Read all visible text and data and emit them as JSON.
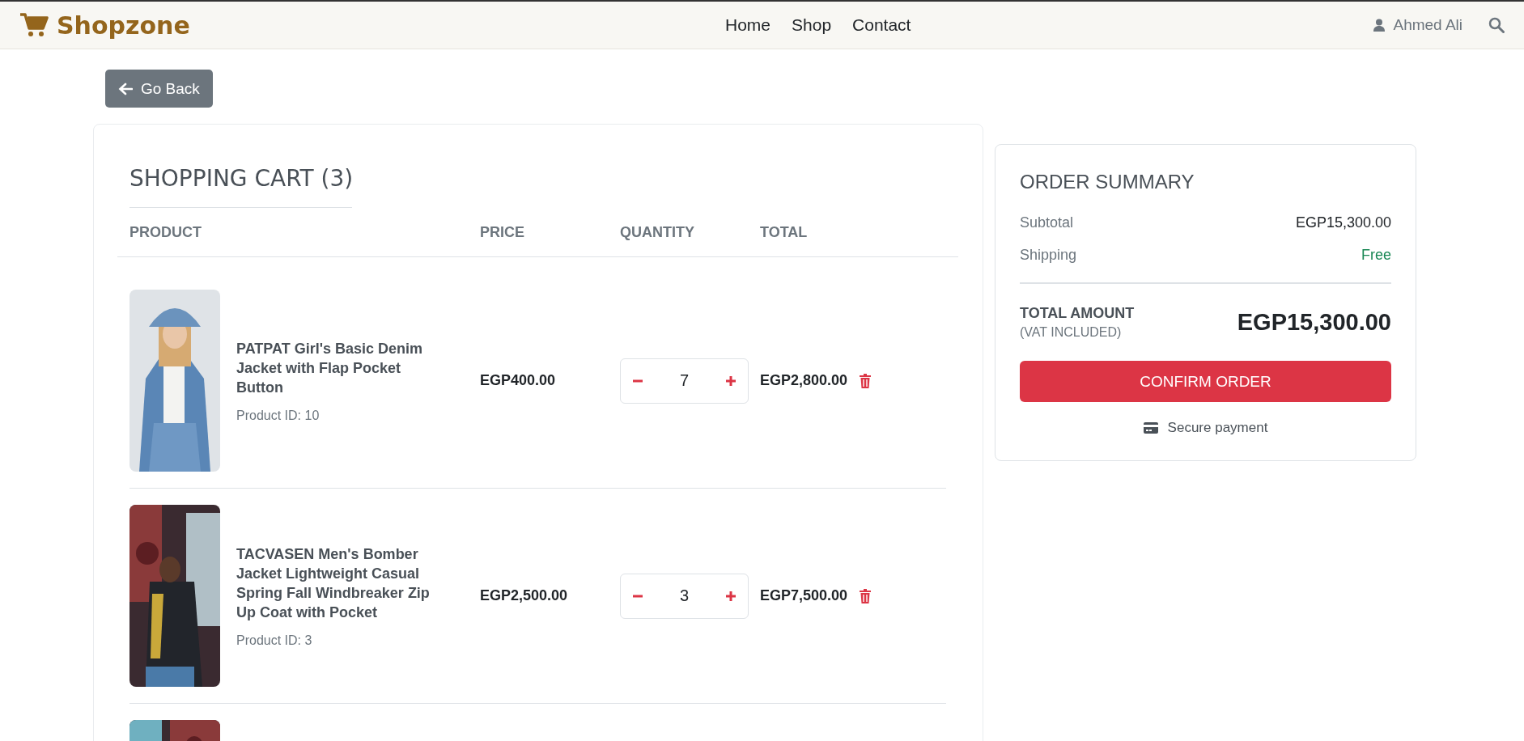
{
  "brand": "Shopzone",
  "nav": [
    "Home",
    "Shop",
    "Contact"
  ],
  "user": "Ahmed Ali",
  "back_button": "Go Back",
  "cart": {
    "title": "SHOPPING CART (3)",
    "columns": [
      "PRODUCT",
      "PRICE",
      "QUANTITY",
      "TOTAL"
    ],
    "items": [
      {
        "kind": "full",
        "name": "PATPAT Girl's Basic Denim Jacket with Flap Pocket Button",
        "product_id": "Product ID: 10",
        "price": "EGP400.00",
        "quantity": "7",
        "total": "EGP2,800.00"
      },
      {
        "kind": "full",
        "name": "TACVASEN Men's Bomber Jacket Lightweight Casual Spring Fall Windbreaker Zip Up Coat with Pocket",
        "product_id": "Product ID: 3",
        "price": "EGP2,500.00",
        "quantity": "3",
        "total": "EGP7,500.00"
      },
      {
        "kind": "partial"
      }
    ]
  },
  "summary": {
    "title": "ORDER SUMMARY",
    "rows": [
      {
        "label": "Subtotal",
        "value": "EGP15,300.00",
        "kind": "amount"
      },
      {
        "label": "Shipping",
        "value": "Free",
        "kind": "free"
      }
    ],
    "total_label": "TOTAL AMOUNT",
    "total_note": "(VAT INCLUDED)",
    "total_value": "EGP15,300.00",
    "confirm_button": "CONFIRM ORDER",
    "secure_note": "Secure payment"
  }
}
